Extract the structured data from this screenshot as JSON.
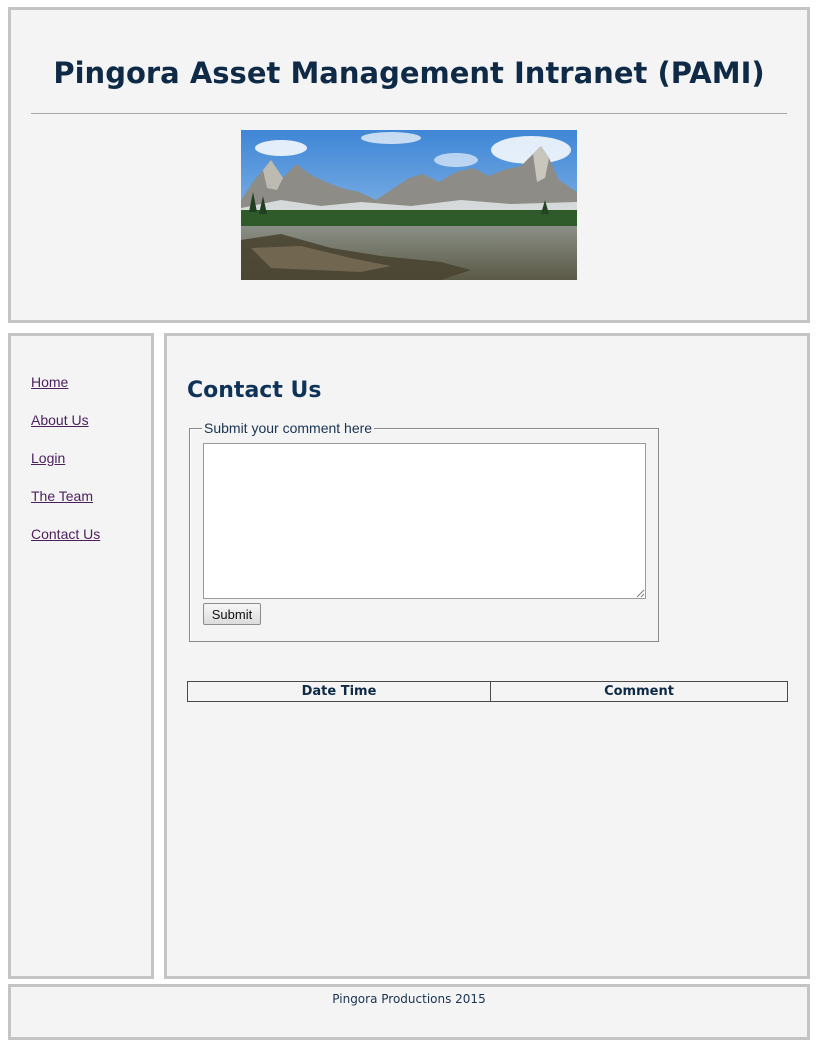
{
  "header": {
    "title": "Pingora Asset Management Intranet (PAMI)",
    "banner_icon": "mountain-lake-photo"
  },
  "nav": {
    "items": [
      {
        "label": "Home"
      },
      {
        "label": "About Us"
      },
      {
        "label": "Login"
      },
      {
        "label": "The Team"
      },
      {
        "label": "Contact Us"
      }
    ],
    "link_color": "#4b1f5c"
  },
  "main": {
    "heading": "Contact Us",
    "form": {
      "legend": "Submit your comment here",
      "textarea_value": "",
      "submit_label": "Submit"
    },
    "table": {
      "columns": [
        "Date Time",
        "Comment"
      ],
      "rows": []
    }
  },
  "footer": {
    "text": "Pingora Productions 2015"
  },
  "colors": {
    "panel_background": "#f4f4f4",
    "panel_border": "#c4c4c4",
    "title": "#0f2a46"
  }
}
